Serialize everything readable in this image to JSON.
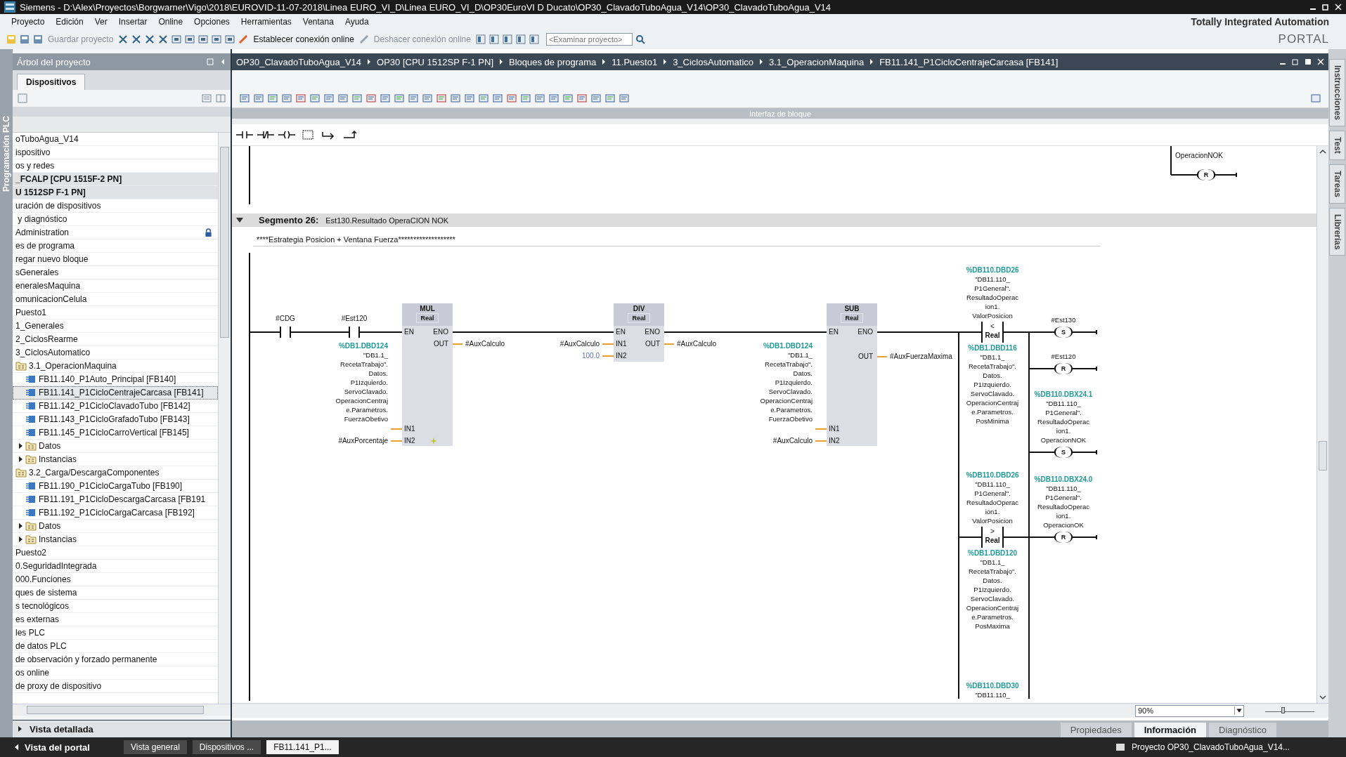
{
  "window": {
    "title": "Siemens  -  D:\\Alex\\Proyectos\\Borgwarner\\Vigo\\2018\\EUROVID-11-07-2018\\Linea EURO_VI_D\\Linea EURO_VI_D\\OP30EuroVI D Ducato\\OP30_ClavadoTuboAgua_V14\\OP30_ClavadoTuboAgua_V14"
  },
  "menu": [
    "Proyecto",
    "Edición",
    "Ver",
    "Insertar",
    "Online",
    "Opciones",
    "Herramientas",
    "Ventana",
    "Ayuda"
  ],
  "toolbar": {
    "save": "Guardar proyecto",
    "connect": "Establecer conexión online",
    "disconnect": "Deshacer conexión online",
    "search_placeholder": "<Examinar proyecto>"
  },
  "brand": {
    "line1": "Totally Integrated Automation",
    "line2": "PORTAL"
  },
  "left_strip": "Programación PLC",
  "project_tree": {
    "title": "Árbol del proyecto",
    "tab": "Dispositivos",
    "items": [
      {
        "label": "oTuboAgua_V14",
        "kind": "plain",
        "selected": false
      },
      {
        "label": "ispositivo",
        "kind": "plain",
        "selected": false
      },
      {
        "label": "os y redes",
        "kind": "plain",
        "selected": false
      },
      {
        "label": "_FCALP [CPU 1515F-2 PN]",
        "kind": "device",
        "selected": false
      },
      {
        "label": "U 1512SP F-1 PN]",
        "kind": "device",
        "selected": false
      },
      {
        "label": "uración de dispositivos",
        "kind": "plain",
        "selected": false
      },
      {
        "label": " y diagnóstico",
        "kind": "plain",
        "selected": false
      },
      {
        "label": "Administration",
        "kind": "protected",
        "selected": false
      },
      {
        "label": "es de programa",
        "kind": "plain",
        "selected": false
      },
      {
        "label": "regar nuevo bloque",
        "kind": "plain",
        "selected": false
      },
      {
        "label": "sGenerales",
        "kind": "plain",
        "selected": false
      },
      {
        "label": "eneralesMaquina",
        "kind": "plain",
        "selected": false
      },
      {
        "label": "omunicacionCelula",
        "kind": "plain",
        "selected": false
      },
      {
        "label": "Puesto1",
        "kind": "plain",
        "selected": false
      },
      {
        "label": "1_Generales",
        "kind": "plain",
        "selected": false
      },
      {
        "label": "2_CiclosRearme",
        "kind": "plain",
        "selected": false
      },
      {
        "label": "3_CiclosAutomatico",
        "kind": "plain",
        "selected": false
      },
      {
        "label": "3.1_OperacionMaquina",
        "kind": "folder",
        "selected": false,
        "children": [
          {
            "label": "FB11.140_P1Auto_Principal [FB140]",
            "kind": "block",
            "selected": false
          },
          {
            "label": "FB11.141_P1CicloCentrajeCarcasa [FB141]",
            "kind": "block",
            "selected": true
          },
          {
            "label": "FB11.142_P1CicloClavadoTubo [FB142]",
            "kind": "block",
            "selected": false
          },
          {
            "label": "FB11.143_P1CicloGrafadoTubo [FB143]",
            "kind": "block",
            "selected": false
          },
          {
            "label": "FB11.145_P1CicloCarroVertical [FB145]",
            "kind": "block",
            "selected": false
          },
          {
            "label": "Datos",
            "kind": "group",
            "selected": false,
            "expanded": false
          },
          {
            "label": "Instancias",
            "kind": "group",
            "selected": false,
            "expanded": false
          }
        ]
      },
      {
        "label": "3.2_Carga/DescargaComponentes",
        "kind": "folder",
        "selected": false,
        "children": [
          {
            "label": "FB11.190_P1CicloCargaTubo [FB190]",
            "kind": "block",
            "selected": false
          },
          {
            "label": "FB11.191_P1CicloDescargaCarcasa [FB191",
            "kind": "block",
            "selected": false
          },
          {
            "label": "FB11.192_P1CicloCargaCarcasa [FB192]",
            "kind": "block",
            "selected": false
          },
          {
            "label": "Datos",
            "kind": "group",
            "selected": false,
            "expanded": false
          },
          {
            "label": "Instancias",
            "kind": "group",
            "selected": false,
            "expanded": false
          }
        ]
      },
      {
        "label": "Puesto2",
        "kind": "plain",
        "selected": false
      },
      {
        "label": "0.SeguridadIntegrada",
        "kind": "plain",
        "selected": false
      },
      {
        "label": "000.Funciones",
        "kind": "plain",
        "selected": false
      },
      {
        "label": "ques de sistema",
        "kind": "plain",
        "selected": false
      },
      {
        "label": "s tecnológicos",
        "kind": "plain",
        "selected": false
      },
      {
        "label": "es externas",
        "kind": "plain",
        "selected": false
      },
      {
        "label": "les PLC",
        "kind": "plain",
        "selected": false
      },
      {
        "label": "de datos PLC",
        "kind": "plain",
        "selected": false
      },
      {
        "label": "de observación y forzado permanente",
        "kind": "plain",
        "selected": false
      },
      {
        "label": "os online",
        "kind": "plain",
        "selected": false
      },
      {
        "label": "de proxy de dispositivo",
        "kind": "plain",
        "selected": false
      }
    ],
    "details": "Vista detallada"
  },
  "editor": {
    "breadcrumbs": [
      "OP30_ClavadoTuboAgua_V14",
      "OP30 [CPU 1512SP F-1 PN]",
      "Bloques de programa",
      "11.Puesto1",
      "3_CiclosAutomatico",
      "3.1_OperacionMaquina",
      "FB11.141_P1CicloCentrajeCarcasa [FB141]"
    ],
    "block_interface": "Interfaz de bloque",
    "zoom": "90%",
    "zoom_slider": {
      "level": 0.35
    },
    "previous": {
      "tag_tail": "OperacionNOK",
      "coil": "R"
    },
    "segment": {
      "label": "Segmento 26:",
      "title": "Est130.Resultado OperaCION NOK",
      "expanded": true,
      "comment": "****Estrategia Posicion + Ventana Fuerza*******************"
    },
    "contacts": [
      {
        "tag": "#CDG"
      },
      {
        "tag": "#Est120"
      }
    ],
    "boxes": [
      {
        "op": "MUL",
        "type": "Real",
        "extendable": true,
        "inputs": [
          {
            "name": "EN"
          },
          {
            "name": "IN1",
            "address": "%DB1.DBD124",
            "operand": "\"DB1.1_RecetaTrabajo\".Datos.P1Izquierdo.ServoClavado.OperacionCentraje.Parametros.FuerzaObetivo",
            "constant": false
          },
          {
            "name": "IN2",
            "operand": "#AuxPorcentaje",
            "constant": false
          }
        ],
        "outputs": [
          {
            "name": "ENO"
          },
          {
            "name": "OUT",
            "operand": "#AuxCalculo"
          }
        ]
      },
      {
        "op": "DIV",
        "type": "Real",
        "extendable": false,
        "inputs": [
          {
            "name": "EN"
          },
          {
            "name": "IN1",
            "operand": "#AuxCalculo",
            "constant": false
          },
          {
            "name": "IN2",
            "operand": "100.0",
            "constant": true
          }
        ],
        "outputs": [
          {
            "name": "ENO"
          },
          {
            "name": "OUT",
            "operand": "#AuxCalculo"
          }
        ]
      },
      {
        "op": "SUB",
        "type": "Real",
        "extendable": false,
        "inputs": [
          {
            "name": "EN"
          },
          {
            "name": "IN1",
            "address": "%DB1.DBD124",
            "operand": "\"DB1.1_RecetaTrabajo\".Datos.P1Izquierdo.ServoClavado.OperacionCentraje.Parametros.FuerzaObetivo",
            "constant": false
          },
          {
            "name": "IN2",
            "operand": "#AuxCalculo",
            "constant": false
          }
        ],
        "outputs": [
          {
            "name": "ENO"
          },
          {
            "name": "OUT",
            "operand": "#AuxFuerzaMaxima"
          }
        ]
      }
    ],
    "compares": [
      {
        "op": "<",
        "type": "Real",
        "in1_address": "%DB110.DBD26",
        "in1": "\"DB11.110_P1General\".ResultadoOperacion1.ValorPosicion",
        "in2_address": "%DB1.DBD116",
        "in2": "\"DB1.1_RecetaTrabajo\".Datos.P1Izquierdo.ServoClavado.OperacionCentraje.Parametros.PosMinima"
      },
      {
        "op": ">",
        "type": "Real",
        "in1_address": "%DB110.DBD26",
        "in1": "\"DB11.110_P1General\".ResultadoOperacion1.ValorPosicion",
        "in2_address": "%DB1.DBD120",
        "in2": "\"DB1.1_RecetaTrabajo\".Datos.P1Izquierdo.ServoClavado.OperacionCentraje.Parametros.PosMaxima"
      }
    ],
    "coils": [
      {
        "op": "S",
        "tag": "#Est130"
      },
      {
        "op": "R",
        "tag": "#Est120"
      },
      {
        "op": "S",
        "address": "%DB110.DBX24.1",
        "tag": "\"DB11.110_P1General\".ResultadoOperacion1.OperacionNOK"
      },
      {
        "op": "R",
        "address": "%DB110.DBX24.0",
        "tag": "\"DB11.110_P1General\".ResultadoOperacion1.OperacionOK"
      }
    ],
    "next": {
      "address": "%DB110.DBD30",
      "tag": "\"DB11.110_"
    }
  },
  "right_tabs": [
    "Instrucciones",
    "Test",
    "Tareas",
    "Librerías"
  ],
  "status_tabs": [
    {
      "label": "Propiedades",
      "selected": false
    },
    {
      "label": "Información",
      "selected": true
    },
    {
      "label": "Diagnóstico",
      "selected": false
    }
  ],
  "taskbar": {
    "portal": "Vista del portal",
    "tabs": [
      {
        "label": "Vista general",
        "selected": false
      },
      {
        "label": "Dispositivos ...",
        "selected": false
      },
      {
        "label": "FB11.141_P1...",
        "selected": true
      }
    ],
    "project": "Proyecto OP30_ClavadoTuboAgua_V14..."
  }
}
